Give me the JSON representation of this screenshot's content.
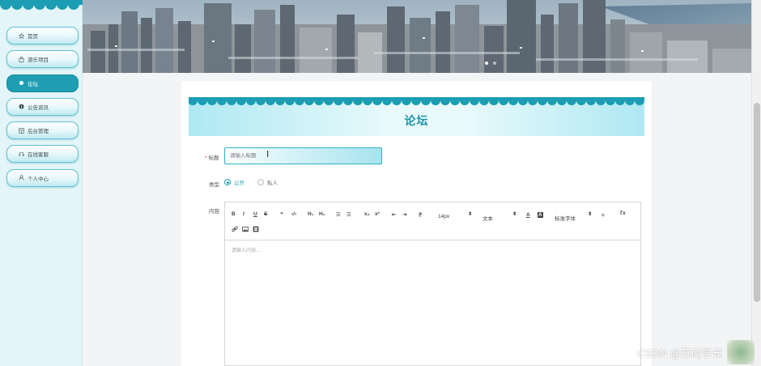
{
  "sidebar": {
    "items": [
      {
        "label": "首页",
        "icon": "star-icon",
        "active": false
      },
      {
        "label": "游乐项目",
        "icon": "bag-icon",
        "active": false
      },
      {
        "label": "论坛",
        "icon": "dot-icon",
        "active": true
      },
      {
        "label": "公告资讯",
        "icon": "info-icon",
        "active": false
      },
      {
        "label": "后台管理",
        "icon": "grid-icon",
        "active": false
      },
      {
        "label": "在线客服",
        "icon": "headset-icon",
        "active": false
      },
      {
        "label": "个人中心",
        "icon": "user-icon",
        "active": false
      }
    ]
  },
  "banner": {
    "slide_count": 2,
    "active_slide": 1
  },
  "form": {
    "page_title": "论坛",
    "title_label": "标题",
    "title_placeholder": "请输入标题",
    "type_label": "类型",
    "type_options": [
      "公开",
      "私人"
    ],
    "type_selected": "公开",
    "content_label": "内容",
    "content_placeholder": "请输入内容..."
  },
  "editor_toolbar": {
    "bold": "B",
    "italic": "I",
    "underline": "U",
    "strike": "S",
    "quote": "❞",
    "code": "‹/›",
    "h1": "H₁",
    "h2": "H₂",
    "ordered_list": "☰",
    "bullet_list": "☰",
    "subscript": "x₂",
    "superscript": "x²",
    "outdent": "⇤",
    "indent": "⇥",
    "direction": "⁋",
    "font_size": "14px",
    "header_select": "文本",
    "font_color": "A",
    "background_color": "A",
    "font_family": "标准字体",
    "align": "≡",
    "clean": "Tx",
    "link": "🔗",
    "image": "▣",
    "video": "▤"
  },
  "watermark": "CSDN @苏南学长",
  "colors": {
    "accent": "#1f9eb3",
    "sidebar_bg": "#e3f5f8",
    "title_text": "#1b93a9"
  }
}
